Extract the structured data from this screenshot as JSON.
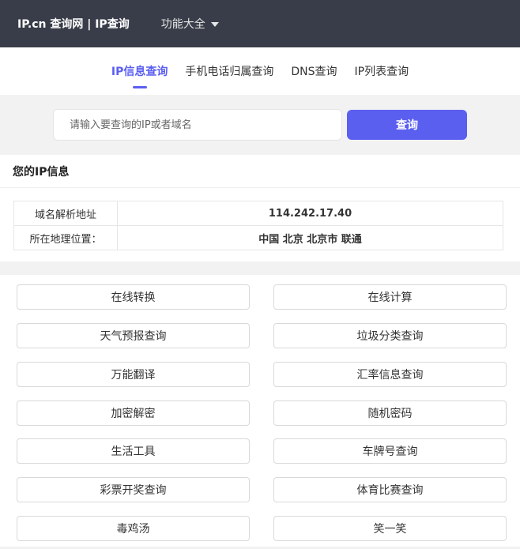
{
  "header": {
    "brand": "IP.cn 查询网 | IP查询",
    "menu_label": "功能大全"
  },
  "tabs": [
    {
      "label": "IP信息查询",
      "active": true
    },
    {
      "label": "手机电话归属查询",
      "active": false
    },
    {
      "label": "DNS查询",
      "active": false
    },
    {
      "label": "IP列表查询",
      "active": false
    }
  ],
  "search": {
    "placeholder": "请输入要查询的IP或者域名",
    "value": "",
    "button_label": "查询"
  },
  "ip_info": {
    "title": "您的IP信息",
    "rows": [
      {
        "key": "域名解析地址",
        "value": "114.242.17.40"
      },
      {
        "key": "所在地理位置：",
        "value": "中国 北京 北京市 联通"
      }
    ]
  },
  "tools": [
    "在线转换",
    "在线计算",
    "天气预报查询",
    "垃圾分类查询",
    "万能翻译",
    "汇率信息查询",
    "加密解密",
    "随机密码",
    "生活工具",
    "车牌号查询",
    "彩票开奖查询",
    "体育比赛查询",
    "毒鸡汤",
    "笑一笑"
  ],
  "colors": {
    "topbar": "#393d49",
    "accent": "#5b5ff0"
  }
}
